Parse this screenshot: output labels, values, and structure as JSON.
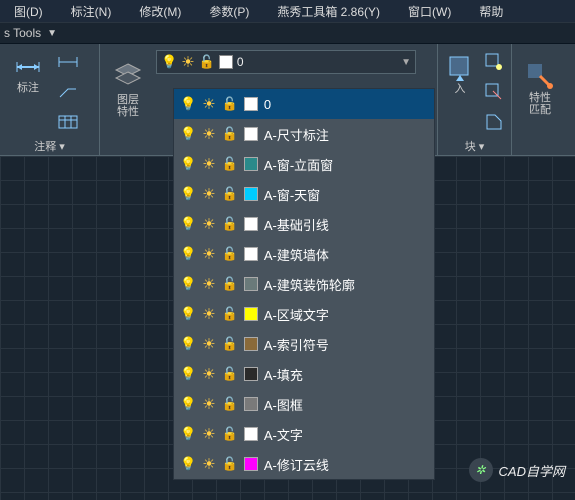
{
  "menu": {
    "items": [
      "图(D)",
      "标注(N)",
      "修改(M)",
      "参数(P)",
      "燕秀工具箱 2.86(Y)",
      "窗口(W)",
      "帮助"
    ]
  },
  "toolsLabel": "s Tools",
  "ribbon": {
    "annotate": {
      "dimLabel": "标注",
      "title": "注释 ▾"
    },
    "layer": {
      "bigLabel": "图层\n特性"
    },
    "selectorValue": "0",
    "insert": {
      "label": "入",
      "title": "块 ▾"
    },
    "props": {
      "label": "特性\n匹配"
    }
  },
  "layers": [
    {
      "name": "0",
      "color": "#ffffff"
    },
    {
      "name": "A-尺寸标注",
      "color": "#ffffff"
    },
    {
      "name": "A-窗-立面窗",
      "color": "#2a8a8a"
    },
    {
      "name": "A-窗-天窗",
      "color": "#00ccff"
    },
    {
      "name": "A-基础引线",
      "color": "#ffffff"
    },
    {
      "name": "A-建筑墙体",
      "color": "#ffffff"
    },
    {
      "name": "A-建筑装饰轮廓",
      "color": "#6a7a7a"
    },
    {
      "name": "A-区域文字",
      "color": "#ffff00"
    },
    {
      "name": "A-索引符号",
      "color": "#8a6a3a"
    },
    {
      "name": "A-填充",
      "color": "#2a2a2a"
    },
    {
      "name": "A-图框",
      "color": "#7a7a7a"
    },
    {
      "name": "A-文字",
      "color": "#ffffff"
    },
    {
      "name": "A-修订云线",
      "color": "#ff00ff"
    }
  ],
  "watermark": "CAD自学网"
}
